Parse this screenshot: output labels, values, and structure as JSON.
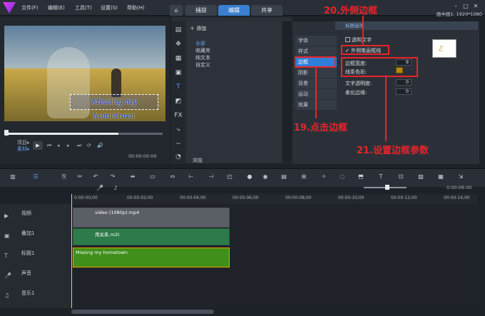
{
  "window": {
    "menus": [
      "文件(F)",
      "编辑(E)",
      "工具(T)",
      "设置(S)",
      "帮助(H)"
    ],
    "tabs": [
      "捕获",
      "编辑",
      "共享"
    ],
    "active_tab": "编辑",
    "status_right": "画中画1, 1920*1080"
  },
  "preview": {
    "overlay_text": "Missing my hometown",
    "mode_project": "项目▸",
    "mode_clip": "素材▸",
    "timecode": "00:00:00:00"
  },
  "library": {
    "add_label": "添加",
    "items": [
      "全部",
      "收藏夹",
      "纯文本",
      "自定义"
    ],
    "browse_label": "浏览"
  },
  "options": {
    "header": "标题选项",
    "tabs": [
      "字体",
      "样式",
      "边框",
      "阴影",
      "背景",
      "运动",
      "效果"
    ],
    "active_tab": "边框",
    "transparent_text": "透明文字",
    "outer_border": "外侧笔画框线",
    "border_width_label": "边框宽度:",
    "border_width_value": "9",
    "line_color_label": "线条色彩:",
    "text_opacity_label": "文字透明度:",
    "text_opacity_value": "0",
    "soft_edge_label": "柔化边缘:",
    "soft_edge_value": "0",
    "line_color": "#b8860b"
  },
  "annotations": {
    "a20": "20.外侧边框",
    "a19": "19.点击边框",
    "a21": "21.设置边框参数"
  },
  "timeline": {
    "ruler": [
      "0:00:00;00",
      "00:00:02;00",
      "00:00:04;00",
      "00:00:06;00",
      "00:00:08;00",
      "00:00:10;00",
      "00:00:12;00",
      "00:00:14;00"
    ],
    "zoom_time": "0:00:06:00",
    "tracks": [
      "视频",
      "叠加1",
      "标题1",
      "声音",
      "音乐1"
    ],
    "clips": {
      "video": "video (1080p).mp4",
      "overlay": "用关系.m2t",
      "title": "Missing my hometown"
    }
  }
}
